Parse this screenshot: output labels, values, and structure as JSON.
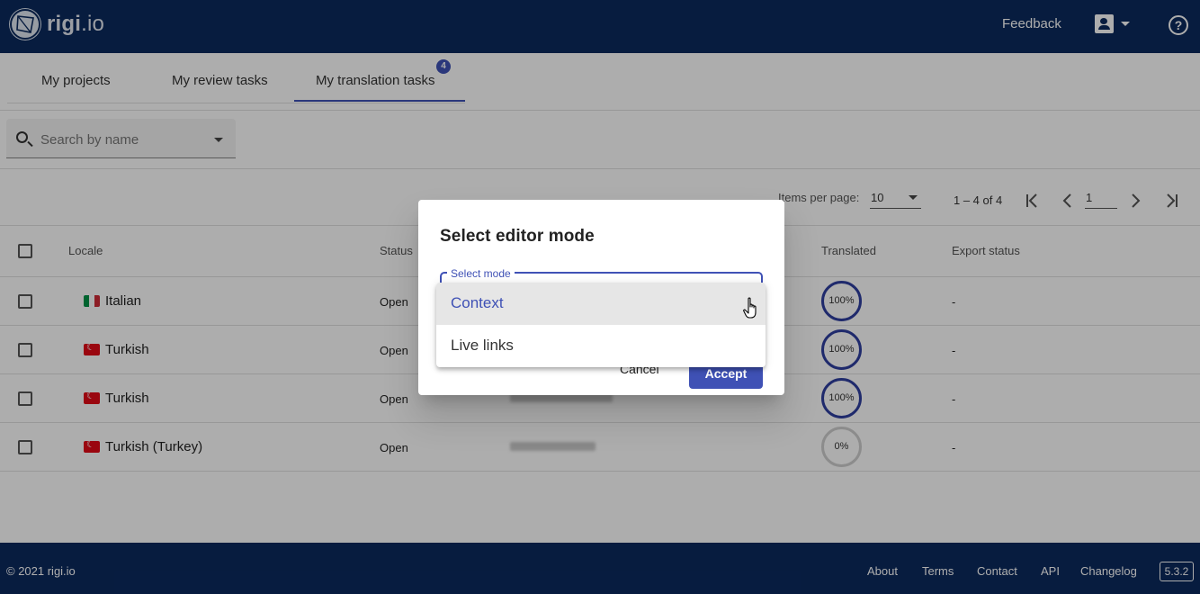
{
  "header": {
    "logo_text_bold": "rigi",
    "logo_text_light": ".io",
    "feedback": "Feedback",
    "account_icon": "account-box-icon",
    "help_icon": "help-circle-icon",
    "help_glyph": "?"
  },
  "tabs": [
    {
      "label": "My projects",
      "active": false
    },
    {
      "label": "My review tasks",
      "active": false
    },
    {
      "label": "My translation tasks",
      "active": true,
      "badge": "4"
    }
  ],
  "search": {
    "placeholder": "Search by name"
  },
  "paginator": {
    "items_per_page_label": "Items per page:",
    "items_per_page_value": "10",
    "range": "1 – 4 of 4",
    "page": "1"
  },
  "table": {
    "columns": [
      "Locale",
      "Status",
      "Translated",
      "Export status"
    ],
    "rows": [
      {
        "locale": "Italian",
        "flag": "it",
        "status": "Open",
        "translated": "100%",
        "translated_value": 100,
        "export": "-"
      },
      {
        "locale": "Turkish",
        "flag": "tr",
        "status": "Open",
        "translated": "100%",
        "translated_value": 100,
        "export": "-"
      },
      {
        "locale": "Turkish",
        "flag": "tr",
        "status": "Open",
        "translated": "100%",
        "translated_value": 100,
        "export": "-"
      },
      {
        "locale": "Turkish (Turkey)",
        "flag": "tr",
        "status": "Open",
        "translated": "0%",
        "translated_value": 0,
        "export": "-"
      }
    ]
  },
  "dialog": {
    "title": "Select editor mode",
    "field_label": "Select mode",
    "options": [
      "Context",
      "Live links"
    ],
    "selected": "Context",
    "cancel": "Cancel",
    "accept": "Accept"
  },
  "footer": {
    "copyright": "© 2021 rigi.io",
    "links": [
      "About",
      "Terms",
      "Contact",
      "API",
      "Changelog"
    ],
    "version": "5.3.2"
  },
  "colors": {
    "brand_navy": "#0b2a5e",
    "accent": "#3f51b5"
  }
}
